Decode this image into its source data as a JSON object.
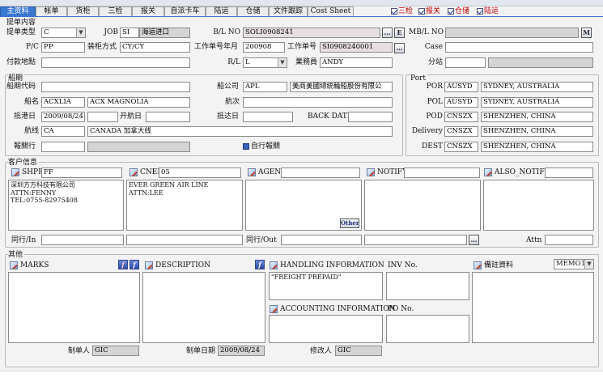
{
  "tabs": [
    "主资料",
    "帐单",
    "货柜",
    "三检",
    "报关",
    "自派卡车",
    "陆运",
    "仓储",
    "文件跟踪",
    "Cost Sheet"
  ],
  "top_flags": [
    "三检",
    "报关",
    "仓储",
    "陆运"
  ],
  "section_booking": {
    "title": "提单内容",
    "type_label": "提单类型",
    "type_value": "C",
    "job_label": "JOB",
    "job_value": "SI",
    "job_desc": "海运进口",
    "bl_no_label": "B/L NO",
    "bl_no_value": "SOLI0908241",
    "btn_e": "E",
    "mbl_label": "MB/L NO",
    "mbl_value": "",
    "btn_m": "M",
    "pc_label": "P/C",
    "pc_value": "PP",
    "load_label": "装柜方式",
    "load_value": "CY/CY",
    "work_ym_label": "工作单号年月",
    "work_ym_value": "200908",
    "work_no_label": "工作单号",
    "work_no_value": "SI0908240001",
    "case_label": "Case",
    "case_value": "",
    "pay_label": "付款地點",
    "pay_value": "",
    "rl_label": "R/L",
    "rl_value": "L",
    "sales_label": "業務員",
    "sales_value": "ANDY",
    "branch_label": "分站",
    "branch_value": ""
  },
  "section_ship": {
    "title": "船期",
    "code_label": "船期代码",
    "code_value": "",
    "carrier_label": "船公司",
    "carrier_value": "APL",
    "carrier_name": "美商美國總統輪船股份有限公",
    "vessel_label": "船名",
    "vessel_code": "ACXLIA",
    "vessel_name": "ACX MAGNOLIA",
    "voyage_label": "航次",
    "voyage_value": "",
    "arrive_label": "抵港日",
    "arrive_value": "2009/08/24",
    "depart_label": "开航日",
    "depart_value": "",
    "atport_label": "抵达日",
    "atport_value": "",
    "backdate_label": "BACK DATE",
    "backdate_value": "",
    "route_label": "航线",
    "route_code": "CA",
    "route_name": "CANADA 加拿大线",
    "customs_label": "報關行",
    "customs_value": "",
    "self_customs": "自行報關"
  },
  "section_port": {
    "title": "Port",
    "rows": [
      {
        "label": "POR",
        "code": "AUSYD",
        "name": "SYDNEY, AUSTRALIA"
      },
      {
        "label": "POL",
        "code": "AUSYD",
        "name": "SYDNEY, AUSTRALIA"
      },
      {
        "label": "POD",
        "code": "CNSZX",
        "name": "SHENZHEN, CHINA"
      },
      {
        "label": "Delivery",
        "code": "CNSZX",
        "name": "SHENZHEN, CHINA"
      },
      {
        "label": "DEST",
        "code": "CNSZX",
        "name": "SHENZHEN, CHINA"
      }
    ]
  },
  "section_client": {
    "title": "客户信息",
    "shpr_label": "SHPR",
    "shpr_value": "FF",
    "shpr_text": "深圳方方科技有限公司\nATTN:FENNY\nTEL:0755-82975408",
    "cnee_label": "CNEE",
    "cnee_value": "05",
    "cnee_text": "EVER GREEN AIR LINE\nATTN:LEE",
    "agent_label": "AGENT",
    "agent_value": "",
    "agent_text": "",
    "other_btn": "Other",
    "notify_label": "NOTIFY",
    "notify_value": "",
    "notify_text": "",
    "also_label": "ALSO_NOTIFY",
    "also_value": "",
    "also_text": "",
    "in_label": "同行/In",
    "in_value": "",
    "out_label": "同行/Out",
    "out_value": "",
    "attn_label": "Attn",
    "attn_value": ""
  },
  "section_other": {
    "title": "其他",
    "marks_label": "MARKS",
    "marks_text": "",
    "desc_label": "DESCRIPTION",
    "desc_text": "",
    "handling_label": "HANDLING INFORMATION",
    "handling_text": "\"FREIGHT PREPAID\"",
    "inv_label": "INV No.",
    "inv_value": "",
    "accounting_label": "ACCOUNTING INFORMATION",
    "accounting_text": "",
    "po_label": "PO No.",
    "po_value": "",
    "remark_label": "備註資料",
    "memo_value": "MEMO1",
    "remark_text": ""
  },
  "footer": {
    "maker_label": "制单人",
    "maker_value": "GIC",
    "make_date_label": "制单日期",
    "make_date_value": "2009/08/24",
    "modifier_label": "修改人",
    "modifier_value": "GIC"
  },
  "colors": {
    "accent": "#3a78d0",
    "flag_text": "#c00000",
    "field_border": "#8a8a8a"
  }
}
